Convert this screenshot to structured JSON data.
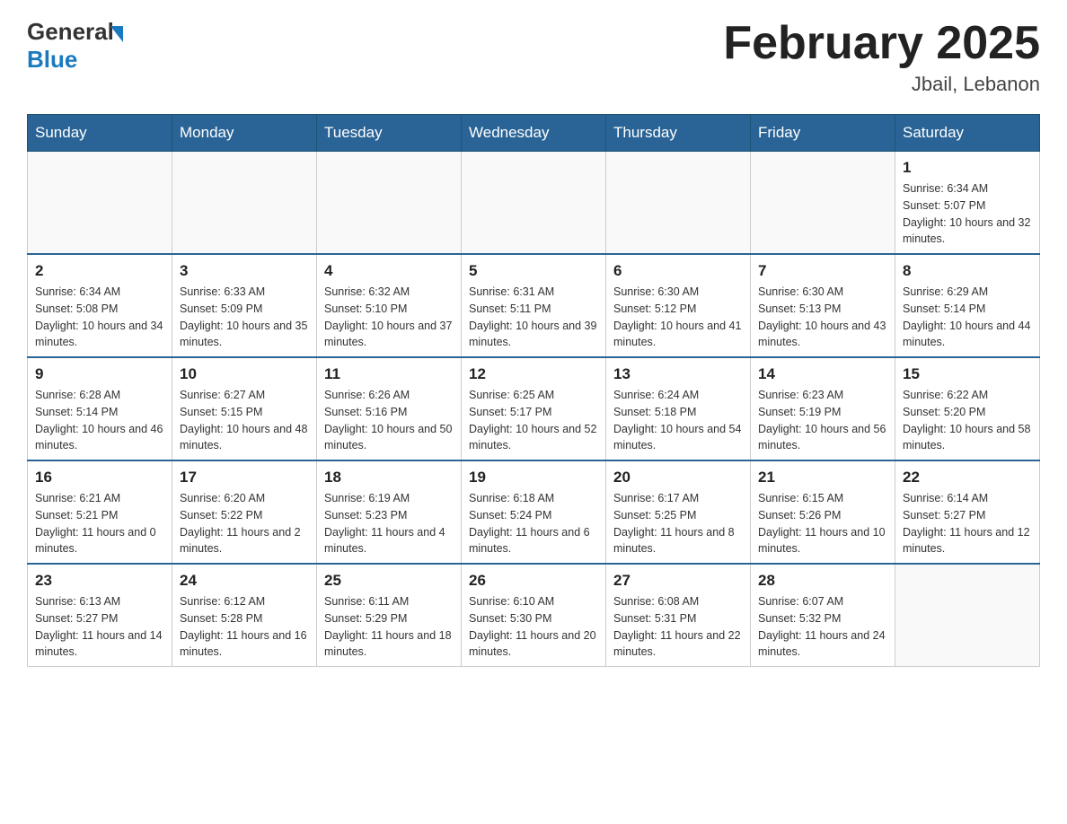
{
  "header": {
    "logo_general": "General",
    "logo_blue": "Blue",
    "month_title": "February 2025",
    "location": "Jbail, Lebanon"
  },
  "days_of_week": [
    "Sunday",
    "Monday",
    "Tuesday",
    "Wednesday",
    "Thursday",
    "Friday",
    "Saturday"
  ],
  "weeks": [
    [
      {
        "day": "",
        "sunrise": "",
        "sunset": "",
        "daylight": ""
      },
      {
        "day": "",
        "sunrise": "",
        "sunset": "",
        "daylight": ""
      },
      {
        "day": "",
        "sunrise": "",
        "sunset": "",
        "daylight": ""
      },
      {
        "day": "",
        "sunrise": "",
        "sunset": "",
        "daylight": ""
      },
      {
        "day": "",
        "sunrise": "",
        "sunset": "",
        "daylight": ""
      },
      {
        "day": "",
        "sunrise": "",
        "sunset": "",
        "daylight": ""
      },
      {
        "day": "1",
        "sunrise": "Sunrise: 6:34 AM",
        "sunset": "Sunset: 5:07 PM",
        "daylight": "Daylight: 10 hours and 32 minutes."
      }
    ],
    [
      {
        "day": "2",
        "sunrise": "Sunrise: 6:34 AM",
        "sunset": "Sunset: 5:08 PM",
        "daylight": "Daylight: 10 hours and 34 minutes."
      },
      {
        "day": "3",
        "sunrise": "Sunrise: 6:33 AM",
        "sunset": "Sunset: 5:09 PM",
        "daylight": "Daylight: 10 hours and 35 minutes."
      },
      {
        "day": "4",
        "sunrise": "Sunrise: 6:32 AM",
        "sunset": "Sunset: 5:10 PM",
        "daylight": "Daylight: 10 hours and 37 minutes."
      },
      {
        "day": "5",
        "sunrise": "Sunrise: 6:31 AM",
        "sunset": "Sunset: 5:11 PM",
        "daylight": "Daylight: 10 hours and 39 minutes."
      },
      {
        "day": "6",
        "sunrise": "Sunrise: 6:30 AM",
        "sunset": "Sunset: 5:12 PM",
        "daylight": "Daylight: 10 hours and 41 minutes."
      },
      {
        "day": "7",
        "sunrise": "Sunrise: 6:30 AM",
        "sunset": "Sunset: 5:13 PM",
        "daylight": "Daylight: 10 hours and 43 minutes."
      },
      {
        "day": "8",
        "sunrise": "Sunrise: 6:29 AM",
        "sunset": "Sunset: 5:14 PM",
        "daylight": "Daylight: 10 hours and 44 minutes."
      }
    ],
    [
      {
        "day": "9",
        "sunrise": "Sunrise: 6:28 AM",
        "sunset": "Sunset: 5:14 PM",
        "daylight": "Daylight: 10 hours and 46 minutes."
      },
      {
        "day": "10",
        "sunrise": "Sunrise: 6:27 AM",
        "sunset": "Sunset: 5:15 PM",
        "daylight": "Daylight: 10 hours and 48 minutes."
      },
      {
        "day": "11",
        "sunrise": "Sunrise: 6:26 AM",
        "sunset": "Sunset: 5:16 PM",
        "daylight": "Daylight: 10 hours and 50 minutes."
      },
      {
        "day": "12",
        "sunrise": "Sunrise: 6:25 AM",
        "sunset": "Sunset: 5:17 PM",
        "daylight": "Daylight: 10 hours and 52 minutes."
      },
      {
        "day": "13",
        "sunrise": "Sunrise: 6:24 AM",
        "sunset": "Sunset: 5:18 PM",
        "daylight": "Daylight: 10 hours and 54 minutes."
      },
      {
        "day": "14",
        "sunrise": "Sunrise: 6:23 AM",
        "sunset": "Sunset: 5:19 PM",
        "daylight": "Daylight: 10 hours and 56 minutes."
      },
      {
        "day": "15",
        "sunrise": "Sunrise: 6:22 AM",
        "sunset": "Sunset: 5:20 PM",
        "daylight": "Daylight: 10 hours and 58 minutes."
      }
    ],
    [
      {
        "day": "16",
        "sunrise": "Sunrise: 6:21 AM",
        "sunset": "Sunset: 5:21 PM",
        "daylight": "Daylight: 11 hours and 0 minutes."
      },
      {
        "day": "17",
        "sunrise": "Sunrise: 6:20 AM",
        "sunset": "Sunset: 5:22 PM",
        "daylight": "Daylight: 11 hours and 2 minutes."
      },
      {
        "day": "18",
        "sunrise": "Sunrise: 6:19 AM",
        "sunset": "Sunset: 5:23 PM",
        "daylight": "Daylight: 11 hours and 4 minutes."
      },
      {
        "day": "19",
        "sunrise": "Sunrise: 6:18 AM",
        "sunset": "Sunset: 5:24 PM",
        "daylight": "Daylight: 11 hours and 6 minutes."
      },
      {
        "day": "20",
        "sunrise": "Sunrise: 6:17 AM",
        "sunset": "Sunset: 5:25 PM",
        "daylight": "Daylight: 11 hours and 8 minutes."
      },
      {
        "day": "21",
        "sunrise": "Sunrise: 6:15 AM",
        "sunset": "Sunset: 5:26 PM",
        "daylight": "Daylight: 11 hours and 10 minutes."
      },
      {
        "day": "22",
        "sunrise": "Sunrise: 6:14 AM",
        "sunset": "Sunset: 5:27 PM",
        "daylight": "Daylight: 11 hours and 12 minutes."
      }
    ],
    [
      {
        "day": "23",
        "sunrise": "Sunrise: 6:13 AM",
        "sunset": "Sunset: 5:27 PM",
        "daylight": "Daylight: 11 hours and 14 minutes."
      },
      {
        "day": "24",
        "sunrise": "Sunrise: 6:12 AM",
        "sunset": "Sunset: 5:28 PM",
        "daylight": "Daylight: 11 hours and 16 minutes."
      },
      {
        "day": "25",
        "sunrise": "Sunrise: 6:11 AM",
        "sunset": "Sunset: 5:29 PM",
        "daylight": "Daylight: 11 hours and 18 minutes."
      },
      {
        "day": "26",
        "sunrise": "Sunrise: 6:10 AM",
        "sunset": "Sunset: 5:30 PM",
        "daylight": "Daylight: 11 hours and 20 minutes."
      },
      {
        "day": "27",
        "sunrise": "Sunrise: 6:08 AM",
        "sunset": "Sunset: 5:31 PM",
        "daylight": "Daylight: 11 hours and 22 minutes."
      },
      {
        "day": "28",
        "sunrise": "Sunrise: 6:07 AM",
        "sunset": "Sunset: 5:32 PM",
        "daylight": "Daylight: 11 hours and 24 minutes."
      },
      {
        "day": "",
        "sunrise": "",
        "sunset": "",
        "daylight": ""
      }
    ]
  ]
}
